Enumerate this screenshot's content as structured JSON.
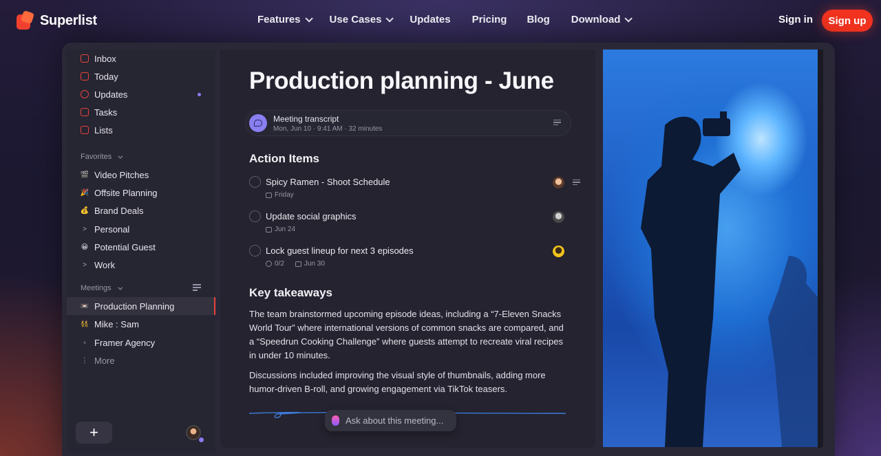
{
  "nav": {
    "brand": "Superlist",
    "links": [
      {
        "label": "Features",
        "dropdown": true
      },
      {
        "label": "Use Cases",
        "dropdown": true
      },
      {
        "label": "Updates",
        "dropdown": false
      },
      {
        "label": "Pricing",
        "dropdown": false
      },
      {
        "label": "Blog",
        "dropdown": false
      },
      {
        "label": "Download",
        "dropdown": true
      }
    ],
    "signin": "Sign in",
    "signup": "Sign up"
  },
  "sidebar": {
    "items": [
      {
        "label": "Inbox",
        "icon": "inbox-icon"
      },
      {
        "label": "Today",
        "icon": "calendar-icon"
      },
      {
        "label": "Updates",
        "icon": "bell-icon"
      },
      {
        "label": "Tasks",
        "icon": "checkbox-icon"
      },
      {
        "label": "Lists",
        "icon": "list-icon"
      }
    ],
    "favorites_label": "Favorites",
    "favorites": [
      {
        "label": "Video Pitches",
        "icon": "🎬"
      },
      {
        "label": "Offsite Planning",
        "icon": "🎉"
      },
      {
        "label": "Brand Deals",
        "icon": "💰"
      },
      {
        "label": "Personal",
        "icon": ">"
      },
      {
        "label": "Potential Guest",
        "icon": "😀"
      },
      {
        "label": "Work",
        "icon": ">"
      }
    ],
    "meetings_label": "Meetings",
    "meetings": [
      {
        "label": "Production Planning",
        "icon": "📼"
      },
      {
        "label": "Mike : Sam",
        "icon": "👯"
      },
      {
        "label": "Framer Agency",
        "icon": "⚫"
      },
      {
        "label": "More",
        "icon": "⋮"
      }
    ],
    "add_label": "+"
  },
  "main": {
    "title": "Production planning - June",
    "transcript": {
      "title": "Meeting transcript",
      "meta": "Mon, Jun 10  ·  9:41 AM  ·  32 minutes"
    },
    "action_items_heading": "Action Items",
    "tasks": [
      {
        "title": "Spicy Ramen - Shoot Schedule",
        "date": "Friday",
        "subtasks": ""
      },
      {
        "title": "Update social graphics",
        "date": "Jun 24",
        "subtasks": ""
      },
      {
        "title": "Lock guest lineup for next 3 episodes",
        "date": "Jun 30",
        "subtasks": "0/2"
      }
    ],
    "takeaways_heading": "Key takeaways",
    "paragraphs": [
      "The team brainstormed upcoming episode ideas, including a “7-Eleven Snacks World Tour” where international versions of common snacks are compared, and a “Speedrun Cooking Challenge” where guests attempt to recreate viral recipes in under 10 minutes.",
      "Discussions included improving the visual style of thumbnails, adding more humor-driven B-roll, and growing engagement via TikTok teasers."
    ],
    "ask_placeholder": "Ask about this meeting..."
  },
  "colors": {
    "accent": "#f0321f",
    "sidebar_bg": "#262532",
    "main_bg": "#24232f",
    "transcript_icon": "#8a7ff0"
  }
}
